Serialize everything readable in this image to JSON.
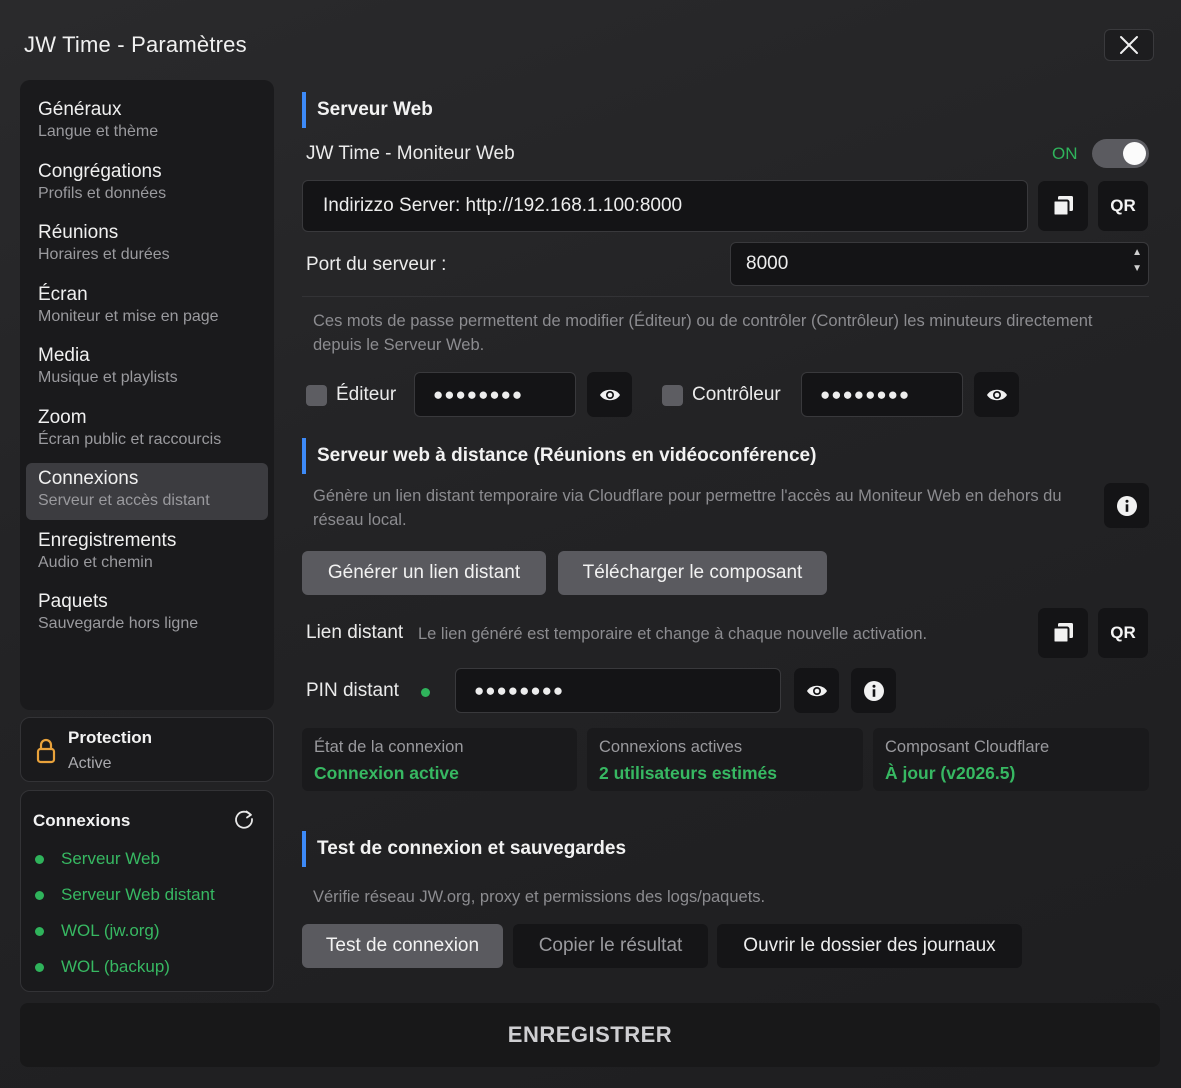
{
  "window": {
    "title": "JW Time - Paramètres"
  },
  "sidebar": {
    "items": [
      {
        "title": "Généraux",
        "subtitle": "Langue et thème"
      },
      {
        "title": "Congrégations",
        "subtitle": "Profils et données"
      },
      {
        "title": "Réunions",
        "subtitle": "Horaires et durées"
      },
      {
        "title": "Écran",
        "subtitle": "Moniteur et mise en page"
      },
      {
        "title": "Media",
        "subtitle": "Musique et playlists"
      },
      {
        "title": "Zoom",
        "subtitle": "Écran public et raccourcis"
      },
      {
        "title": "Connexions",
        "subtitle": "Serveur et accès distant"
      },
      {
        "title": "Enregistrements",
        "subtitle": "Audio et chemin"
      },
      {
        "title": "Paquets",
        "subtitle": "Sauvegarde hors ligne"
      }
    ],
    "active_index": 6,
    "protection": {
      "title": "Protection",
      "status": "Active"
    },
    "connections": {
      "title": "Connexions",
      "items": [
        "Serveur Web",
        "Serveur Web distant",
        "WOL (jw.org)",
        "WOL (backup)"
      ]
    }
  },
  "web_server": {
    "heading": "Serveur Web",
    "monitor_label": "JW Time - Moniteur Web",
    "toggle_label": "ON",
    "address": "Indirizzo Server: http://192.168.1.100:8000",
    "qr_label": "QR",
    "port_label": "Port du serveur :",
    "port_value": "8000",
    "password_help": "Ces mots de passe permettent de modifier (Éditeur) ou de contrôler (Contrôleur) les minuteurs directement depuis le Serveur Web.",
    "editor_label": "Éditeur",
    "editor_password": "●●●●●●●●",
    "controller_label": "Contrôleur",
    "controller_password": "●●●●●●●●"
  },
  "remote_server": {
    "heading": "Serveur web à distance (Réunions en vidéoconférence)",
    "description": "Génère un lien distant temporaire via Cloudflare pour permettre l'accès au Moniteur Web en dehors du réseau local.",
    "generate_label": "Générer un lien distant",
    "download_label": "Télécharger le composant",
    "link_label": "Lien distant",
    "link_hint": "Le lien généré est temporaire et change à chaque nouvelle activation.",
    "qr_label": "QR",
    "pin_label": "PIN distant",
    "pin_value": "●●●●●●●●",
    "status_cards": [
      {
        "label": "État de la connexion",
        "value": "Connexion active"
      },
      {
        "label": "Connexions actives",
        "value": "2 utilisateurs estimés"
      },
      {
        "label": "Composant Cloudflare",
        "value": "À jour (v2026.5)"
      }
    ]
  },
  "connection_test": {
    "heading": "Test de connexion et sauvegardes",
    "description": "Vérifie réseau JW.org, proxy et permissions des logs/paquets.",
    "test_label": "Test de connexion",
    "copy_label": "Copier le résultat",
    "open_logs_label": "Ouvrir le dossier des journaux"
  },
  "footer": {
    "save_label": "ENREGISTRER"
  },
  "colors": {
    "accent": "#3d8af7",
    "success": "#2fb35b",
    "lock": "#e9a23b"
  }
}
